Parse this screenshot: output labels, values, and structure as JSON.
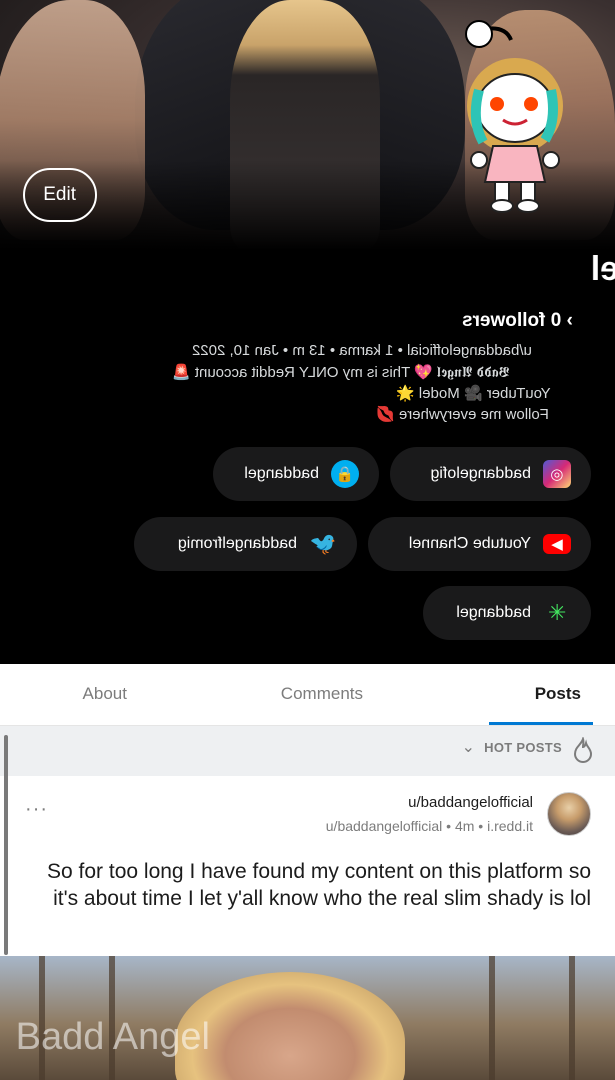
{
  "header": {
    "edit_label": "Edit"
  },
  "profile": {
    "display_name": "Badd Angel",
    "followers_text": "0 followers",
    "followers_chevron": "›",
    "meta_line": "u/baddangelofficial • 1 karma • 13 m • Jan 10, 2022",
    "bio_lines": [
      "𝕭𝖆𝖉𝖉 𝕬𝖓𝖌𝖊𝖑 💖 This is my ONLY Reddit account 🚨",
      "YouTuber 🎥 Model 🌟",
      "Follow me everywhere 💋"
    ]
  },
  "social_links": [
    {
      "label": "baddangelofig",
      "icon": "instagram-icon",
      "color": "#d62976"
    },
    {
      "label": "baddangel",
      "icon": "onlyfans-lock-icon",
      "color": "#00aff0"
    },
    {
      "label": "Youtube Channel",
      "icon": "youtube-icon",
      "color": "#ff0000"
    },
    {
      "label": "baddangelfromig",
      "icon": "twitter-icon",
      "color": "#1da1f2"
    },
    {
      "label": "baddangel",
      "icon": "linktree-icon",
      "color": "#43e660"
    }
  ],
  "tabs": [
    {
      "label": "Posts",
      "active": true
    },
    {
      "label": "Comments",
      "active": false
    },
    {
      "label": "About",
      "active": false
    }
  ],
  "sort": {
    "label": "HOT POSTS",
    "icon": "flame-icon"
  },
  "post": {
    "username": "u/baddangelofficial",
    "subline": "u/baddangelofficial • 4m • i.redd.it",
    "more": "···",
    "title": "So for too long I have found my content on this platform so it's about time I let y'all know who the real slim shady is lol",
    "image_watermark": "Badd Angel"
  },
  "colors": {
    "accent": "#0079d3",
    "background_dark": "#000000",
    "chip_bg": "#1a1a1b"
  }
}
